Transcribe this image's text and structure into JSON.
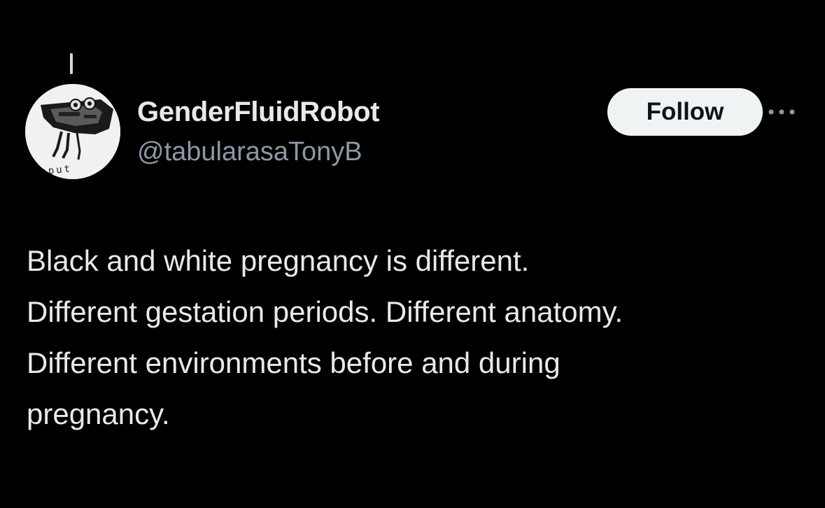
{
  "tweet": {
    "author": {
      "display_name": "GenderFluidRobot",
      "handle": "@tabularasaTonyB",
      "avatar_label": "input"
    },
    "follow_label": "Follow",
    "more_icon": "more-horizontal-icon",
    "text_lines": [
      "Black and white pregnancy is different.",
      "Different gestation periods. Different anatomy.",
      "Different environments before and during",
      "pregnancy."
    ]
  },
  "colors": {
    "background": "#000000",
    "primary_text": "#e7e9ea",
    "secondary_text": "#8b98a5",
    "follow_bg": "#eff3f4",
    "follow_text": "#0f1419"
  }
}
